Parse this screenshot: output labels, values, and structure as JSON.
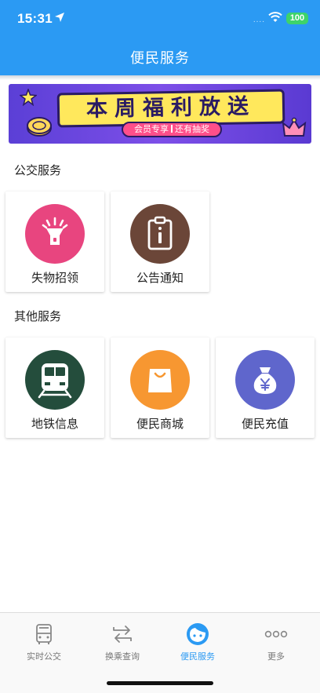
{
  "status_bar": {
    "time": "15:31",
    "signal": "....",
    "battery": "100"
  },
  "header": {
    "title": "便民服务"
  },
  "banner": {
    "headline": "本周福利放送",
    "pill_left": "会员专享",
    "pill_right": "还有抽奖"
  },
  "sections": [
    {
      "title": "公交服务",
      "items": [
        {
          "label": "失物招领",
          "icon": "flashlight-icon",
          "color": "#e8457f"
        },
        {
          "label": "公告通知",
          "icon": "clipboard-icon",
          "color": "#6b4638"
        }
      ]
    },
    {
      "title": "其他服务",
      "items": [
        {
          "label": "地铁信息",
          "icon": "subway-icon",
          "color": "#244d3c"
        },
        {
          "label": "便民商城",
          "icon": "shopping-bag-icon",
          "color": "#f79731"
        },
        {
          "label": "便民充值",
          "icon": "money-bag-icon",
          "color": "#5f66cc"
        }
      ]
    }
  ],
  "tabbar": {
    "items": [
      {
        "label": "实时公交",
        "icon": "bus-icon",
        "active": false
      },
      {
        "label": "换乘查询",
        "icon": "transfer-icon",
        "active": false
      },
      {
        "label": "便民服务",
        "icon": "face-icon",
        "active": true
      },
      {
        "label": "更多",
        "icon": "more-icon",
        "active": false
      }
    ]
  },
  "colors": {
    "primary": "#2b9af3",
    "battery": "#3ed36a"
  }
}
